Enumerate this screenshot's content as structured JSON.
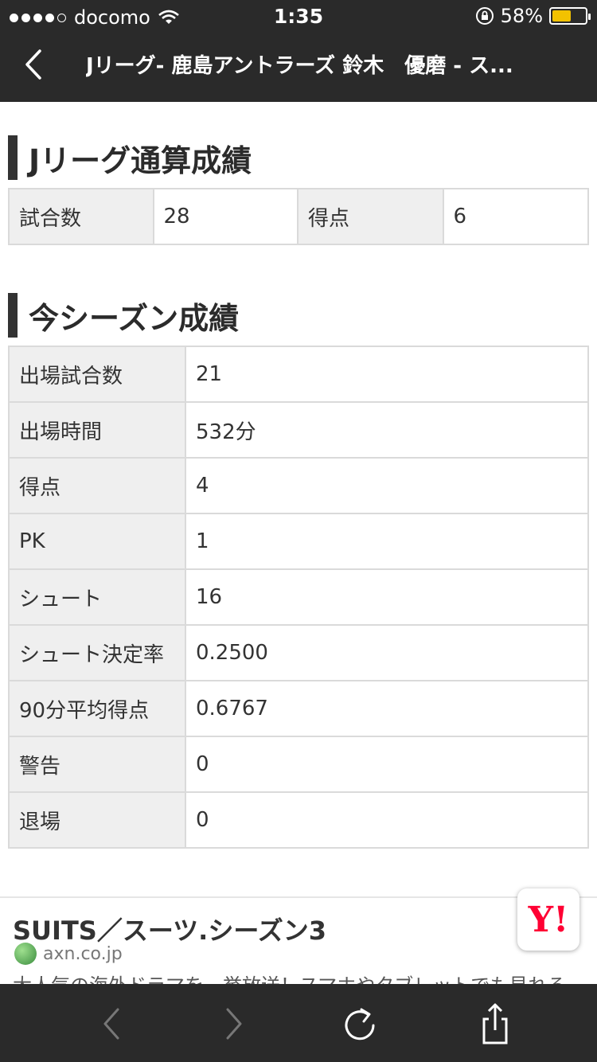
{
  "status_bar": {
    "carrier": "docomo",
    "time": "1:35",
    "battery": "58%",
    "battery_level": 0.58
  },
  "nav": {
    "title": "Jリーグ- 鹿島アントラーズ 鈴木　優磨 - ス..."
  },
  "career": {
    "heading": "Jリーグ通算成績",
    "cells": [
      "試合数",
      "28",
      "得点",
      "6"
    ]
  },
  "season": {
    "heading": "今シーズン成績",
    "rows": [
      {
        "label": "出場試合数",
        "value": "21"
      },
      {
        "label": "出場時間",
        "value": "532分"
      },
      {
        "label": "得点",
        "value": "4"
      },
      {
        "label": "PK",
        "value": "1"
      },
      {
        "label": "シュート",
        "value": "16"
      },
      {
        "label": "シュート決定率",
        "value": "0.2500"
      },
      {
        "label": "90分平均得点",
        "value": "0.6767"
      },
      {
        "label": "警告",
        "value": "0"
      },
      {
        "label": "退場",
        "value": "0"
      }
    ]
  },
  "ad": {
    "title": "SUITS／スーツ.シーズン3",
    "domain": "axn.co.jp",
    "description": "大人気の海外ドラマを一挙放送！スマホやタブレットでも見れる"
  },
  "yahoo_badge": "Y!",
  "icons": [
    "wifi-icon",
    "orientation-lock-icon",
    "battery-icon",
    "back-chevron-icon",
    "browser-back-icon",
    "browser-forward-icon",
    "reload-icon",
    "share-icon"
  ],
  "colors": {
    "header_bg": "#2a2a2a",
    "label_bg": "#efefef",
    "border": "#dadada",
    "battery": "#f2c200",
    "yahoo_red": "#ff0033"
  }
}
